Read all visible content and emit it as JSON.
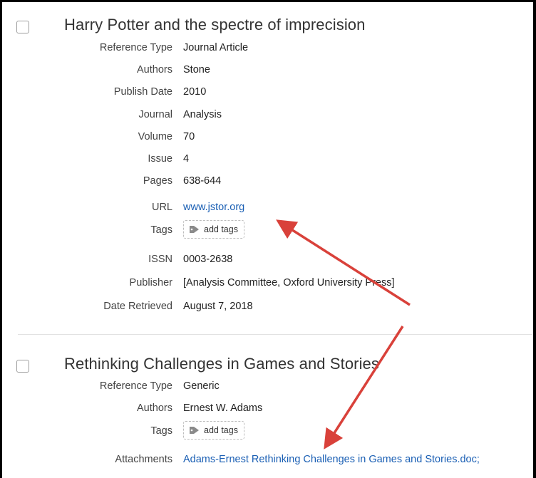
{
  "records": [
    {
      "title": "Harry Potter and the spectre of imprecision",
      "fields": {
        "reference_type": {
          "label": "Reference Type",
          "value": "Journal Article"
        },
        "authors": {
          "label": "Authors",
          "value": "Stone"
        },
        "publish_date": {
          "label": "Publish Date",
          "value": "2010"
        },
        "journal": {
          "label": "Journal",
          "value": "Analysis"
        },
        "volume": {
          "label": "Volume",
          "value": "70"
        },
        "issue": {
          "label": "Issue",
          "value": "4"
        },
        "pages": {
          "label": "Pages",
          "value": "638-644"
        },
        "url": {
          "label": "URL",
          "value": "www.jstor.org"
        },
        "tags": {
          "label": "Tags",
          "button": "add tags"
        },
        "issn": {
          "label": "ISSN",
          "value": "0003-2638"
        },
        "publisher": {
          "label": "Publisher",
          "value": "[Analysis Committee, Oxford University Press]"
        },
        "date_retrieved": {
          "label": "Date Retrieved",
          "value": "August 7, 2018"
        }
      }
    },
    {
      "title": "Rethinking Challenges in Games and Stories",
      "fields": {
        "reference_type": {
          "label": "Reference Type",
          "value": "Generic"
        },
        "authors": {
          "label": "Authors",
          "value": "Ernest W. Adams"
        },
        "tags": {
          "label": "Tags",
          "button": "add tags"
        },
        "attachments": {
          "label": "Attachments",
          "value": "Adams-Ernest Rethinking Challenges in Games and Stories.doc;"
        }
      }
    }
  ],
  "colors": {
    "link": "#1a5fb4",
    "annotation_arrow": "#d9413a"
  },
  "icons": {
    "tag": "tag-icon",
    "checkbox": "checkbox-icon"
  }
}
